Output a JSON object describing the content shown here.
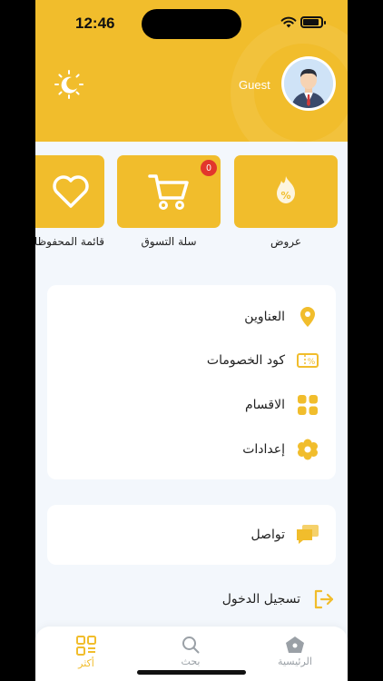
{
  "status_bar": {
    "time": "12:46"
  },
  "header": {
    "user_name": "Guest"
  },
  "quick_actions": [
    {
      "label": "عروض",
      "icon": "discount-icon"
    },
    {
      "label": "سلة التسوق",
      "icon": "cart-icon",
      "badge": "0"
    },
    {
      "label": "قائمة المحفوظات",
      "icon": "heart-icon"
    }
  ],
  "menu": [
    {
      "label": "العناوين",
      "icon": "location-pin-icon"
    },
    {
      "label": "كود الخصومات",
      "icon": "coupon-icon"
    },
    {
      "label": "الاقسام",
      "icon": "categories-icon"
    },
    {
      "label": "إعدادات",
      "icon": "settings-icon"
    }
  ],
  "contact": {
    "label": "تواصل",
    "icon": "chat-icon"
  },
  "login": {
    "label": "تسجيل الدخول",
    "icon": "login-icon"
  },
  "bottom_nav": [
    {
      "label": "الرئيسية",
      "icon": "home-icon"
    },
    {
      "label": "بحث",
      "icon": "search-icon"
    },
    {
      "label": "أكثر",
      "icon": "more-grid-icon",
      "active": true
    }
  ],
  "colors": {
    "primary": "#f1bd2c",
    "accent": "#e2362c",
    "background": "#f3f7fc",
    "inactive": "#9aa0a6"
  }
}
